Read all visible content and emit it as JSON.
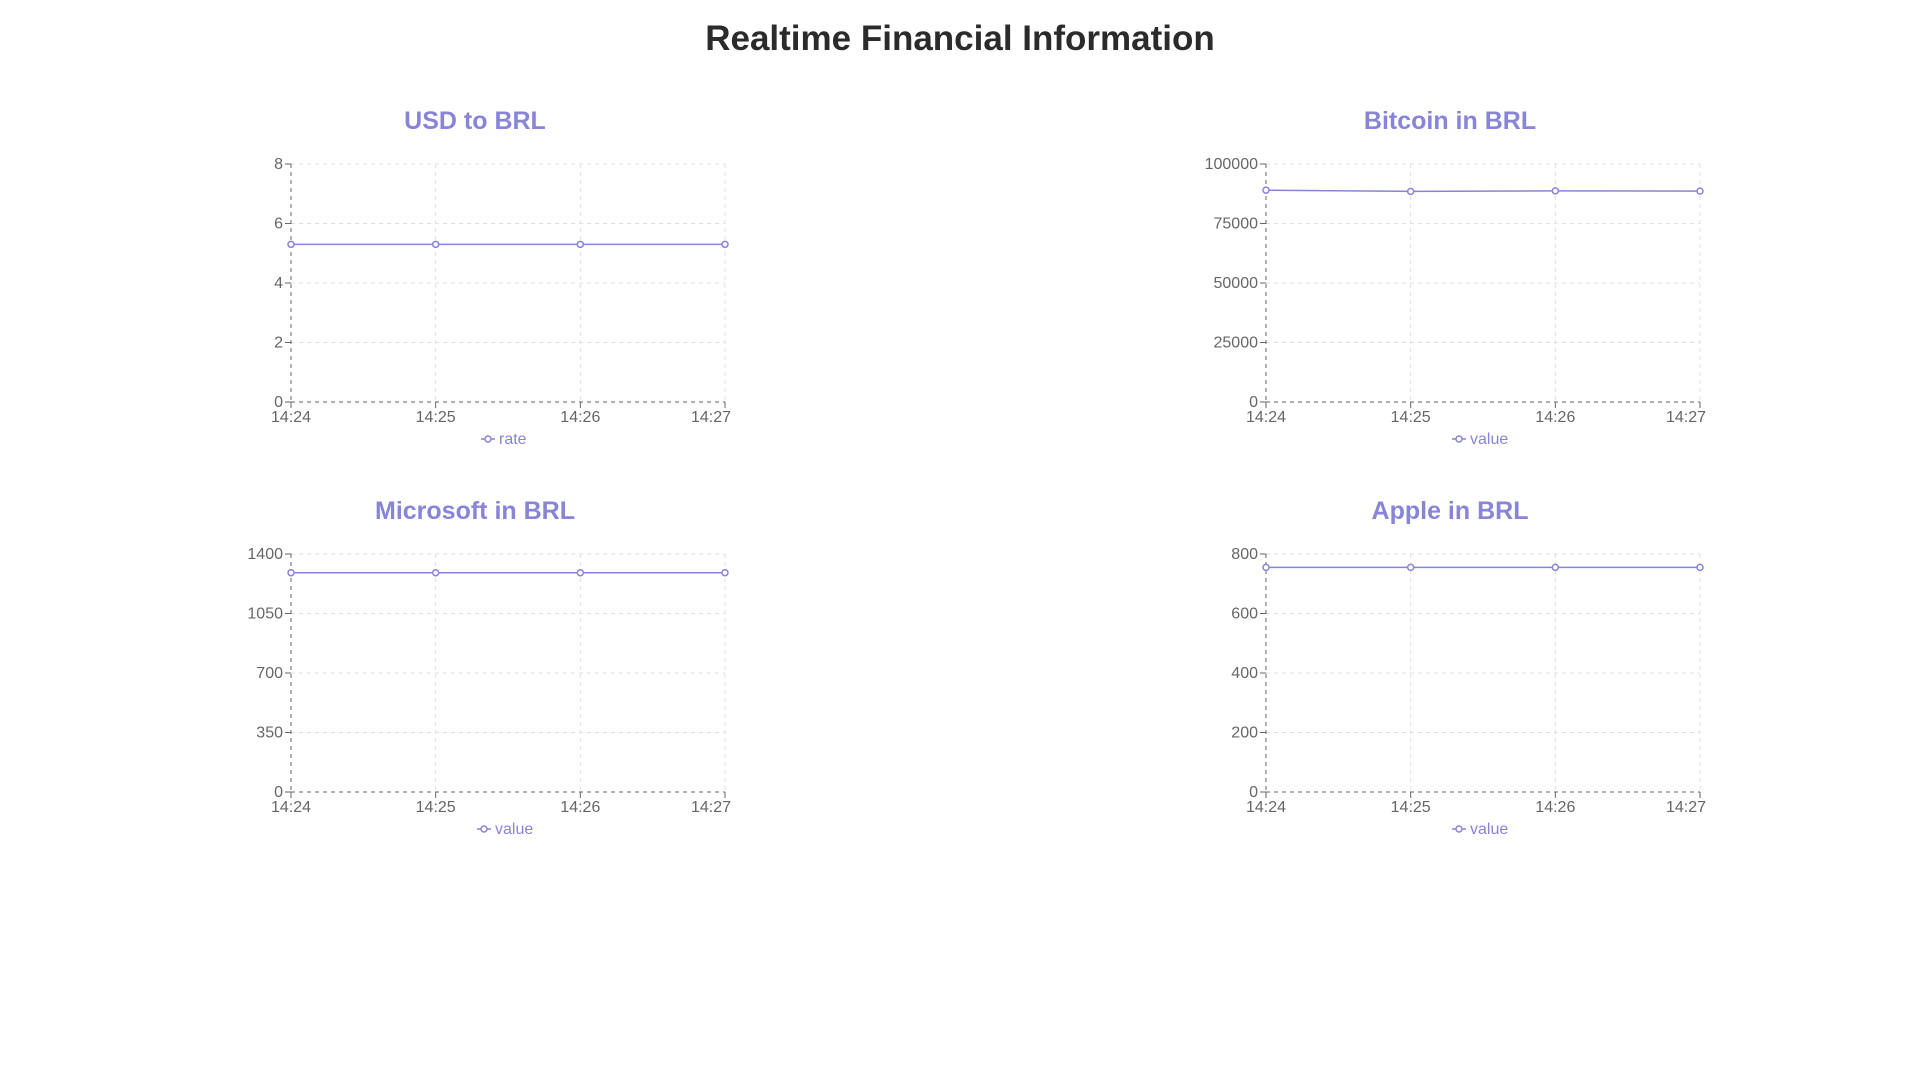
{
  "page": {
    "title": "Realtime Financial Information"
  },
  "colors": {
    "series": "#8884d8",
    "axis": "#666666",
    "grid": "#e0e0e0",
    "title": "#2b2b2b"
  },
  "chart_data": [
    {
      "type": "line",
      "title": "USD to BRL",
      "x": [
        "14:24",
        "14:25",
        "14:26",
        "14:27"
      ],
      "ylim": [
        0,
        8
      ],
      "yticks": [
        0,
        2,
        4,
        6,
        8
      ],
      "grid": true,
      "legend_position": "bottom",
      "series": [
        {
          "name": "rate",
          "values": [
            5.3,
            5.3,
            5.3,
            5.3
          ]
        }
      ]
    },
    {
      "type": "line",
      "title": "Bitcoin in BRL",
      "x": [
        "14:24",
        "14:25",
        "14:26",
        "14:27"
      ],
      "ylim": [
        0,
        100000
      ],
      "yticks": [
        0,
        25000,
        50000,
        75000,
        100000
      ],
      "grid": true,
      "legend_position": "bottom",
      "series": [
        {
          "name": "value",
          "values": [
            89000,
            88500,
            88700,
            88600
          ]
        }
      ]
    },
    {
      "type": "line",
      "title": "Microsoft in BRL",
      "x": [
        "14:24",
        "14:25",
        "14:26",
        "14:27"
      ],
      "ylim": [
        0,
        1400
      ],
      "yticks": [
        0,
        350,
        700,
        1050,
        1400
      ],
      "grid": true,
      "legend_position": "bottom",
      "series": [
        {
          "name": "value",
          "values": [
            1290,
            1290,
            1290,
            1290
          ]
        }
      ]
    },
    {
      "type": "line",
      "title": "Apple in BRL",
      "x": [
        "14:24",
        "14:25",
        "14:26",
        "14:27"
      ],
      "ylim": [
        0,
        800
      ],
      "yticks": [
        0,
        200,
        400,
        600,
        800
      ],
      "grid": true,
      "legend_position": "bottom",
      "series": [
        {
          "name": "value",
          "values": [
            755,
            755,
            755,
            755
          ]
        }
      ]
    }
  ]
}
